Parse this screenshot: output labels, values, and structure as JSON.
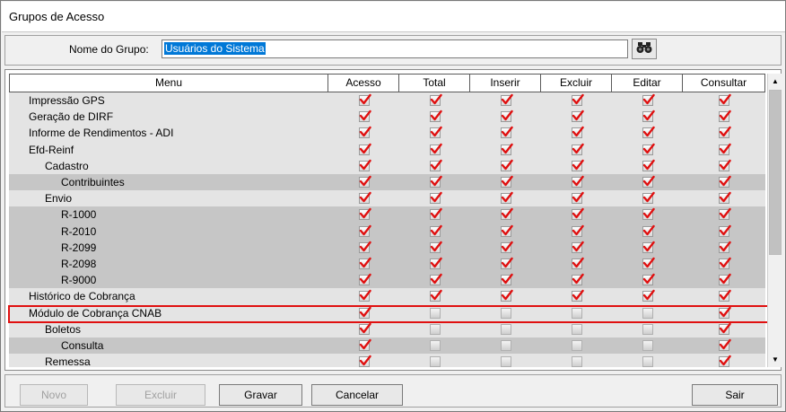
{
  "window": {
    "title": "Grupos de Acesso"
  },
  "group": {
    "label": "Nome do Grupo:",
    "value": "Usuários do Sistema"
  },
  "icons": {
    "search": "binoculars-icon",
    "checked": "red-checkmark-icon",
    "unchecked": "empty-checkbox-icon",
    "scroll_up": "arrow-up-icon",
    "scroll_down": "arrow-down-icon"
  },
  "colors": {
    "check": "#e01010",
    "highlight": "#e01010",
    "selection": "#0078d7"
  },
  "grid": {
    "columns": [
      "Menu",
      "Acesso",
      "Total",
      "Inserir",
      "Excluir",
      "Editar",
      "Consultar"
    ],
    "rows": [
      {
        "menu": "Impressão GPS",
        "level": 1,
        "checks": [
          true,
          true,
          true,
          true,
          true,
          true
        ]
      },
      {
        "menu": "Geração de DIRF",
        "level": 1,
        "checks": [
          true,
          true,
          true,
          true,
          true,
          true
        ]
      },
      {
        "menu": "Informe de Rendimentos - ADI",
        "level": 1,
        "checks": [
          true,
          true,
          true,
          true,
          true,
          true
        ]
      },
      {
        "menu": "Efd-Reinf",
        "level": 1,
        "checks": [
          true,
          true,
          true,
          true,
          true,
          true
        ]
      },
      {
        "menu": "Cadastro",
        "level": 2,
        "checks": [
          true,
          true,
          true,
          true,
          true,
          true
        ]
      },
      {
        "menu": "Contribuintes",
        "level": 3,
        "checks": [
          true,
          true,
          true,
          true,
          true,
          true
        ]
      },
      {
        "menu": "Envio",
        "level": 2,
        "checks": [
          true,
          true,
          true,
          true,
          true,
          true
        ]
      },
      {
        "menu": "R-1000",
        "level": 3,
        "checks": [
          true,
          true,
          true,
          true,
          true,
          true
        ]
      },
      {
        "menu": "R-2010",
        "level": 3,
        "checks": [
          true,
          true,
          true,
          true,
          true,
          true
        ]
      },
      {
        "menu": "R-2099",
        "level": 3,
        "checks": [
          true,
          true,
          true,
          true,
          true,
          true
        ]
      },
      {
        "menu": "R-2098",
        "level": 3,
        "checks": [
          true,
          true,
          true,
          true,
          true,
          true
        ]
      },
      {
        "menu": "R-9000",
        "level": 3,
        "checks": [
          true,
          true,
          true,
          true,
          true,
          true
        ]
      },
      {
        "menu": "Histórico de Cobrança",
        "level": 1,
        "checks": [
          true,
          true,
          true,
          true,
          true,
          true
        ]
      },
      {
        "menu": "Módulo de Cobrança CNAB",
        "level": 1,
        "checks": [
          true,
          false,
          false,
          false,
          false,
          true
        ]
      },
      {
        "menu": "Boletos",
        "level": 2,
        "checks": [
          true,
          false,
          false,
          false,
          false,
          true
        ]
      },
      {
        "menu": "Consulta",
        "level": 3,
        "checks": [
          true,
          false,
          false,
          false,
          false,
          true
        ]
      },
      {
        "menu": "Remessa",
        "level": 2,
        "checks": [
          true,
          false,
          false,
          false,
          false,
          true
        ]
      }
    ]
  },
  "buttons": {
    "novo": "Novo",
    "excluir": "Excluir",
    "gravar": "Gravar",
    "cancelar": "Cancelar",
    "sair": "Sair"
  }
}
